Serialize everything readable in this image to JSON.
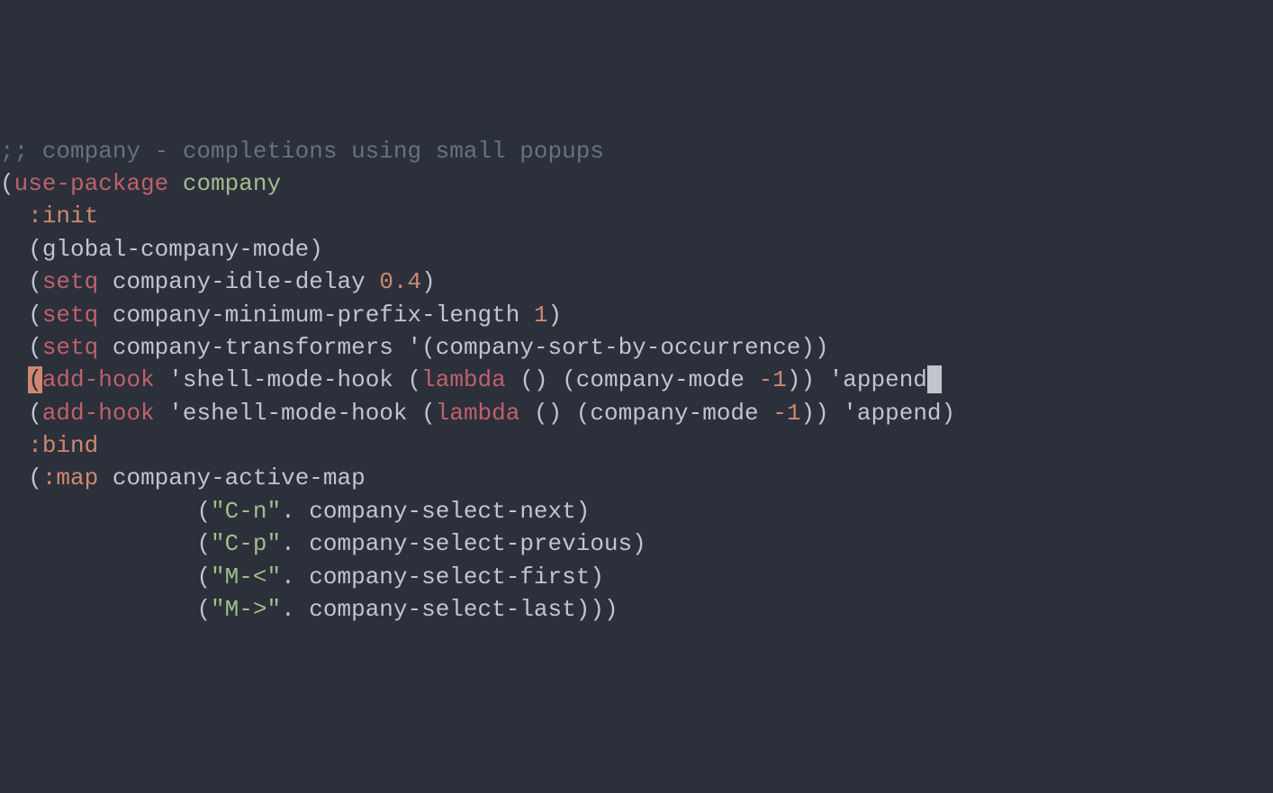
{
  "code": {
    "l1_comment": ";; company - completions using small popups",
    "l2": {
      "p1": "(",
      "fn": "use-package",
      "sp": " ",
      "pkg": "company"
    },
    "l3": {
      "indent": "  ",
      "kw": ":init"
    },
    "l4": {
      "indent": "  ",
      "p1": "(",
      "fn": "global-company-mode",
      "p2": ")"
    },
    "l5": {
      "indent": "  ",
      "p1": "(",
      "fn": "setq",
      "sp": " ",
      "var": "company-idle-delay ",
      "num": "0.4",
      "p2": ")"
    },
    "l6": {
      "indent": "  ",
      "p1": "(",
      "fn": "setq",
      "sp": " ",
      "var": "company-minimum-prefix-length ",
      "num": "1",
      "p2": ")"
    },
    "l7": {
      "indent": "  ",
      "p1": "(",
      "fn": "setq",
      "sp": " ",
      "var": "company-transformers ",
      "q": "'",
      "p2": "(",
      "sym": "company-sort-by-occurrence",
      "p3": ")",
      "p4": ")"
    },
    "l8": {
      "indent": "  ",
      "p1": "(",
      "fn": "add-hook",
      "sp": " ",
      "q1": "'",
      "hook": "shell-mode-hook ",
      "p2": "(",
      "lam": "lambda",
      "sp2": " ",
      "p3": "()",
      "sp3": " ",
      "p4": "(",
      "cm": "company-mode ",
      "neg": "-1",
      "p5": ")",
      "p6": ")",
      "sp4": " ",
      "q2": "'",
      "app": "append"
    },
    "l9": {
      "indent": "  ",
      "p1": "(",
      "fn": "add-hook",
      "sp": " ",
      "q1": "'",
      "hook": "eshell-mode-hook ",
      "p2": "(",
      "lam": "lambda",
      "sp2": " ",
      "p3": "()",
      "sp3": " ",
      "p4": "(",
      "cm": "company-mode ",
      "neg": "-1",
      "p5": ")",
      "p6": ")",
      "sp4": " ",
      "q2": "'",
      "app": "append",
      "p7": ")"
    },
    "l10": {
      "indent": "  ",
      "kw": ":bind"
    },
    "l11": {
      "indent": "  ",
      "p1": "(",
      "kw": ":map",
      "sp": " ",
      "var": "company-active-map"
    },
    "l12": {
      "indent": "              ",
      "p1": "(",
      "str": "\"C-n\"",
      "dot": ". ",
      "sym": "company-select-next",
      "p2": ")"
    },
    "l13": {
      "indent": "              ",
      "p1": "(",
      "str": "\"C-p\"",
      "dot": ". ",
      "sym": "company-select-previous",
      "p2": ")"
    },
    "l14": {
      "indent": "              ",
      "p1": "(",
      "str": "\"M-<\"",
      "dot": ". ",
      "sym": "company-select-first",
      "p2": ")"
    },
    "l15": {
      "indent": "              ",
      "p1": "(",
      "str": "\"M->\"",
      "dot": ". ",
      "sym": "company-select-last",
      "p2": ")",
      "p3": ")",
      "p4": ")"
    }
  }
}
